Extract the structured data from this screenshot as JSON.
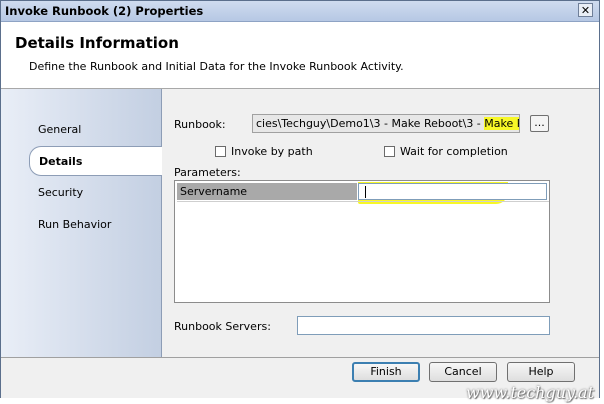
{
  "window": {
    "title": "Invoke Runbook (2) Properties",
    "close_glyph": "✕"
  },
  "header": {
    "title": "Details Information",
    "subtitle": "Define the Runbook and Initial Data for the Invoke Runbook Activity."
  },
  "sidebar": {
    "items": [
      {
        "label": "General",
        "active": false
      },
      {
        "label": "Details",
        "active": true
      },
      {
        "label": "Security",
        "active": false
      },
      {
        "label": "Run Behavior",
        "active": false
      }
    ]
  },
  "details": {
    "runbook_label": "Runbook:",
    "runbook_value_prefix": "cies\\Techguy\\Demo1\\3 - Make Reboot\\3 - ",
    "runbook_value_highlight": "Make Reboot",
    "browse_label": "...",
    "invoke_by_path_label": "Invoke by path",
    "invoke_by_path_checked": false,
    "wait_label": "Wait for completion",
    "wait_checked": false,
    "parameters_label": "Parameters:",
    "parameters": [
      {
        "name": "Servername",
        "value": ""
      }
    ],
    "runbook_servers_label": "Runbook Servers:",
    "runbook_servers_value": ""
  },
  "footer": {
    "finish_label": "Finish",
    "cancel_label": "Cancel",
    "help_label": "Help"
  },
  "watermark": "www.techguy.at",
  "colors": {
    "highlight": "#f7f727",
    "title_bar": "#b6c8e4",
    "sidebar": "#c3cfe2"
  }
}
